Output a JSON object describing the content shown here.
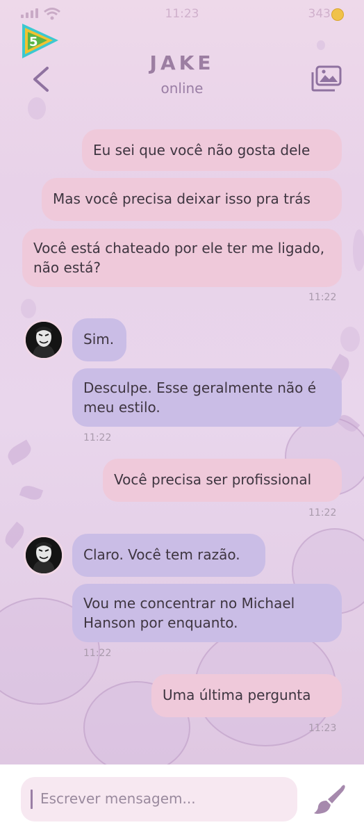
{
  "status_bar": {
    "time": "11:23",
    "coins": "343"
  },
  "app_logo": {
    "badge_number": "5"
  },
  "header": {
    "contact_name": "JAKE",
    "status": "online"
  },
  "messages": [
    {
      "side": "out",
      "text": "Eu sei que você não gosta dele"
    },
    {
      "side": "out",
      "text": "Mas você precisa deixar isso pra trás"
    },
    {
      "side": "out",
      "text": "Você está chateado por ele ter me ligado, não está?",
      "time": "11:22"
    },
    {
      "side": "in",
      "text": "Sim."
    },
    {
      "side": "in",
      "text": "Desculpe. Esse geralmente não é meu estilo.",
      "time": "11:22"
    },
    {
      "side": "out",
      "text": "Você precisa ser profissional",
      "time": "11:22"
    },
    {
      "side": "in",
      "text": "Claro. Você tem razão."
    },
    {
      "side": "in",
      "text": "Vou me concentrar no Michael Hanson por enquanto.",
      "time": "11:22"
    },
    {
      "side": "out",
      "text": "Uma última pergunta",
      "time": "11:23"
    }
  ],
  "composer": {
    "placeholder": "Escrever mensagem..."
  },
  "colors": {
    "outgoing_bubble": "#efc9da",
    "incoming_bubble": "#cabde6",
    "accent": "#9a7ea5"
  }
}
